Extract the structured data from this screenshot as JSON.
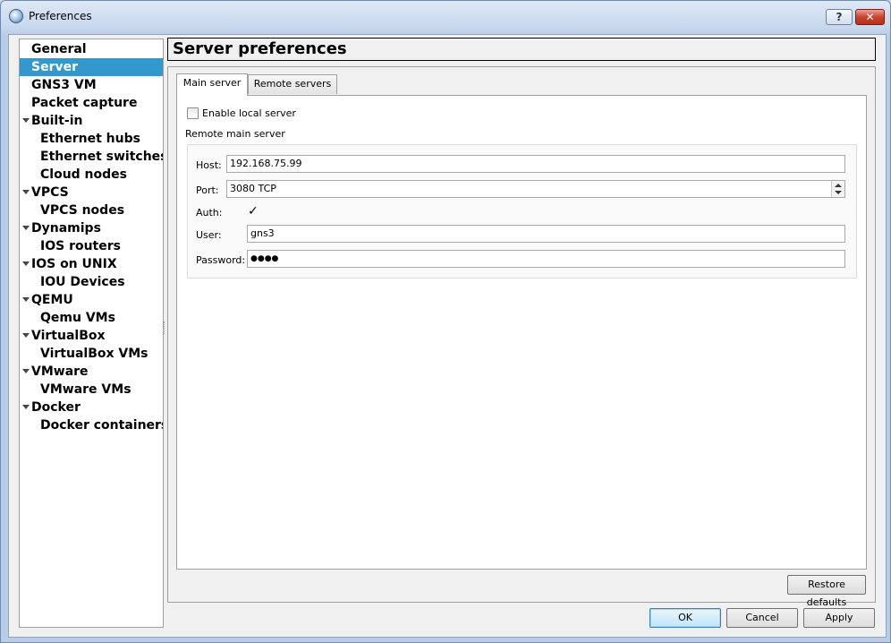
{
  "window": {
    "title": "Preferences",
    "help_label": "?",
    "close_label": "✕"
  },
  "sidebar": {
    "items": [
      {
        "label": "General",
        "level": 0,
        "expandable": false,
        "selected": false
      },
      {
        "label": "Server",
        "level": 0,
        "expandable": false,
        "selected": true
      },
      {
        "label": "GNS3 VM",
        "level": 0,
        "expandable": false,
        "selected": false
      },
      {
        "label": "Packet capture",
        "level": 0,
        "expandable": false,
        "selected": false
      },
      {
        "label": "Built-in",
        "level": 0,
        "expandable": true,
        "selected": false
      },
      {
        "label": "Ethernet hubs",
        "level": 1,
        "expandable": false,
        "selected": false
      },
      {
        "label": "Ethernet switches",
        "level": 1,
        "expandable": false,
        "selected": false
      },
      {
        "label": "Cloud nodes",
        "level": 1,
        "expandable": false,
        "selected": false
      },
      {
        "label": "VPCS",
        "level": 0,
        "expandable": true,
        "selected": false
      },
      {
        "label": "VPCS nodes",
        "level": 1,
        "expandable": false,
        "selected": false
      },
      {
        "label": "Dynamips",
        "level": 0,
        "expandable": true,
        "selected": false
      },
      {
        "label": "IOS routers",
        "level": 1,
        "expandable": false,
        "selected": false
      },
      {
        "label": "IOS on UNIX",
        "level": 0,
        "expandable": true,
        "selected": false
      },
      {
        "label": "IOU Devices",
        "level": 1,
        "expandable": false,
        "selected": false
      },
      {
        "label": "QEMU",
        "level": 0,
        "expandable": true,
        "selected": false
      },
      {
        "label": "Qemu VMs",
        "level": 1,
        "expandable": false,
        "selected": false
      },
      {
        "label": "VirtualBox",
        "level": 0,
        "expandable": true,
        "selected": false
      },
      {
        "label": "VirtualBox VMs",
        "level": 1,
        "expandable": false,
        "selected": false
      },
      {
        "label": "VMware",
        "level": 0,
        "expandable": true,
        "selected": false
      },
      {
        "label": "VMware VMs",
        "level": 1,
        "expandable": false,
        "selected": false
      },
      {
        "label": "Docker",
        "level": 0,
        "expandable": true,
        "selected": false
      },
      {
        "label": "Docker containers",
        "level": 1,
        "expandable": false,
        "selected": false
      }
    ]
  },
  "page": {
    "title": "Server preferences",
    "tabs": [
      {
        "label": "Main server",
        "active": true
      },
      {
        "label": "Remote servers",
        "active": false
      }
    ],
    "enable_local_server": {
      "label": "Enable local server",
      "checked": false
    },
    "remote_group_label": "Remote main server",
    "host": {
      "label": "Host:",
      "value": "192.168.75.99"
    },
    "port": {
      "label": "Port:",
      "value": "3080 TCP"
    },
    "auth": {
      "label": "Auth:",
      "checked": true,
      "mark": "✓"
    },
    "user": {
      "label": "User:",
      "value": "gns3"
    },
    "password": {
      "label": "Password:",
      "value": "●●●●"
    },
    "restore_defaults_label": "Restore defaults"
  },
  "footer": {
    "ok_label": "OK",
    "cancel_label": "Cancel",
    "apply_label": "Apply"
  },
  "colors": {
    "selection": "#3399cc",
    "title_bar": "#c7d7ed",
    "close_button": "#c7432e"
  }
}
